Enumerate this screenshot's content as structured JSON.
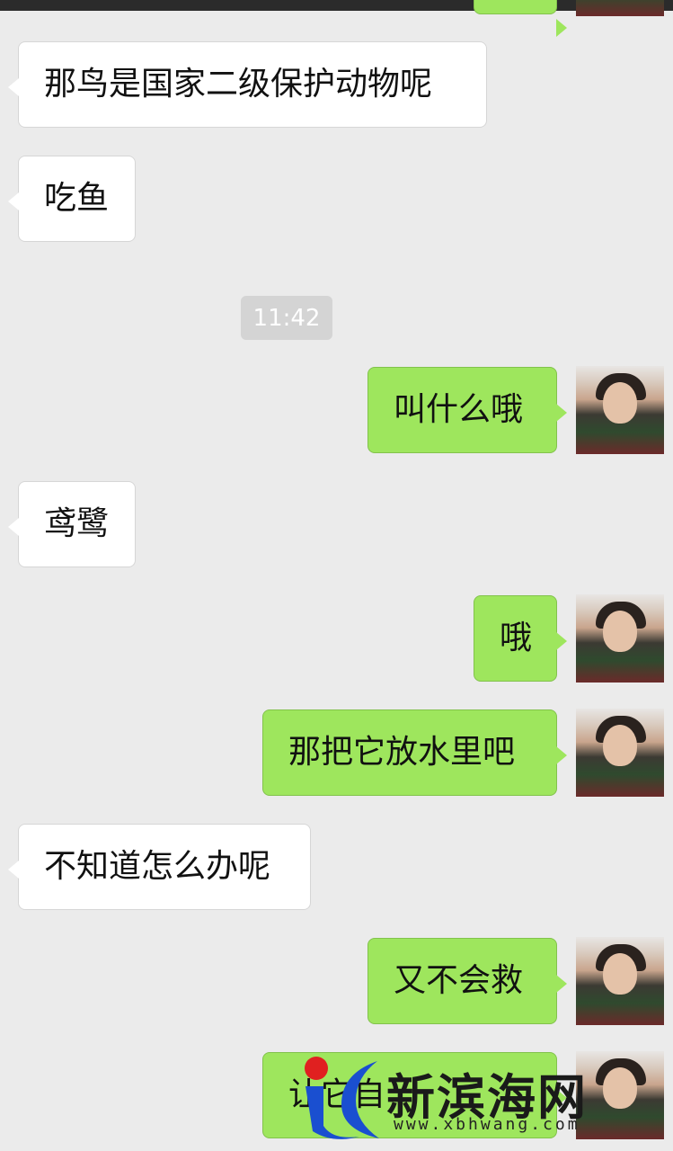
{
  "timestamp": "11:42",
  "messages": [
    {
      "side": "left",
      "text": "那鸟是国家二级保护动物呢"
    },
    {
      "side": "left",
      "text": "吃鱼"
    },
    {
      "side": "right",
      "text": "叫什么哦"
    },
    {
      "side": "left",
      "text": "鸢鹭"
    },
    {
      "side": "right",
      "text": "哦"
    },
    {
      "side": "right",
      "text": "那把它放水里吧"
    },
    {
      "side": "left",
      "text": "不知道怎么办呢"
    },
    {
      "side": "right",
      "text": "又不会救"
    },
    {
      "side": "right",
      "text": "让它自"
    }
  ],
  "watermark": {
    "title": "新滨海网",
    "url": "www.xbhwang.com",
    "colors": {
      "red": "#e02020",
      "blue": "#1a4fd0"
    }
  },
  "colors": {
    "background": "#ebebeb",
    "bubble_left": "#ffffff",
    "bubble_right": "#9ee65d",
    "timestamp_bg": "#d4d4d4"
  }
}
